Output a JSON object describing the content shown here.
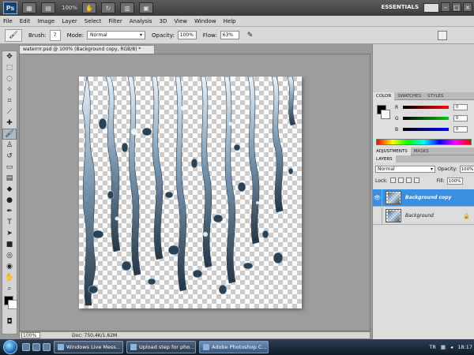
{
  "app": {
    "logo": "Ps",
    "zoom_display": "100%",
    "workspace": "ESSENTIALS",
    "window_buttons": [
      "–",
      "□",
      "×"
    ]
  },
  "menu": [
    "File",
    "Edit",
    "Image",
    "Layer",
    "Select",
    "Filter",
    "Analysis",
    "3D",
    "View",
    "Window",
    "Help"
  ],
  "options": {
    "brush_label": "Brush:",
    "brush_size": "7",
    "mode_label": "Mode:",
    "mode_value": "Normal",
    "opacity_label": "Opacity:",
    "opacity_value": "100%",
    "flow_label": "Flow:",
    "flow_value": "63%"
  },
  "document": {
    "tab_title": "waterrrr.psd @ 100% (Background copy, RGB/8) *",
    "status_zoom": "100%",
    "doc_info": "Doc: 750,4K/1,62M"
  },
  "panels": {
    "color_tabs": [
      "COLOR",
      "SWATCHES",
      "STYLES"
    ],
    "adjust_tabs": [
      "ADJUSTMENTS",
      "MASKS"
    ],
    "layers_tab": "LAYERS",
    "color_channels": [
      {
        "ch": "R",
        "value": "0",
        "color": "#d00000"
      },
      {
        "ch": "G",
        "value": "0",
        "color": "#00a000"
      },
      {
        "ch": "B",
        "value": "0",
        "color": "#0000d0"
      }
    ],
    "layers": {
      "blend_mode": "Normal",
      "opacity_label": "Opacity:",
      "opacity_value": "100%",
      "lock_label": "Lock:",
      "fill_label": "Fill:",
      "fill_value": "100%",
      "items": [
        {
          "name": "Background copy",
          "visible": true,
          "selected": true
        },
        {
          "name": "Background",
          "visible": false,
          "selected": false
        }
      ],
      "bottom_icons": [
        "link-icon",
        "fx-icon",
        "mask-icon",
        "adjustment-icon",
        "group-icon",
        "new-layer-icon",
        "trash-icon"
      ]
    }
  },
  "taskbar": {
    "buttons": [
      "Windows Live Mess...",
      "Upload step for pho...",
      "Adobe Photoshop C..."
    ],
    "active_index": 2,
    "language": "TR",
    "time": "18:17"
  },
  "accent_color": "#3b8fe0"
}
